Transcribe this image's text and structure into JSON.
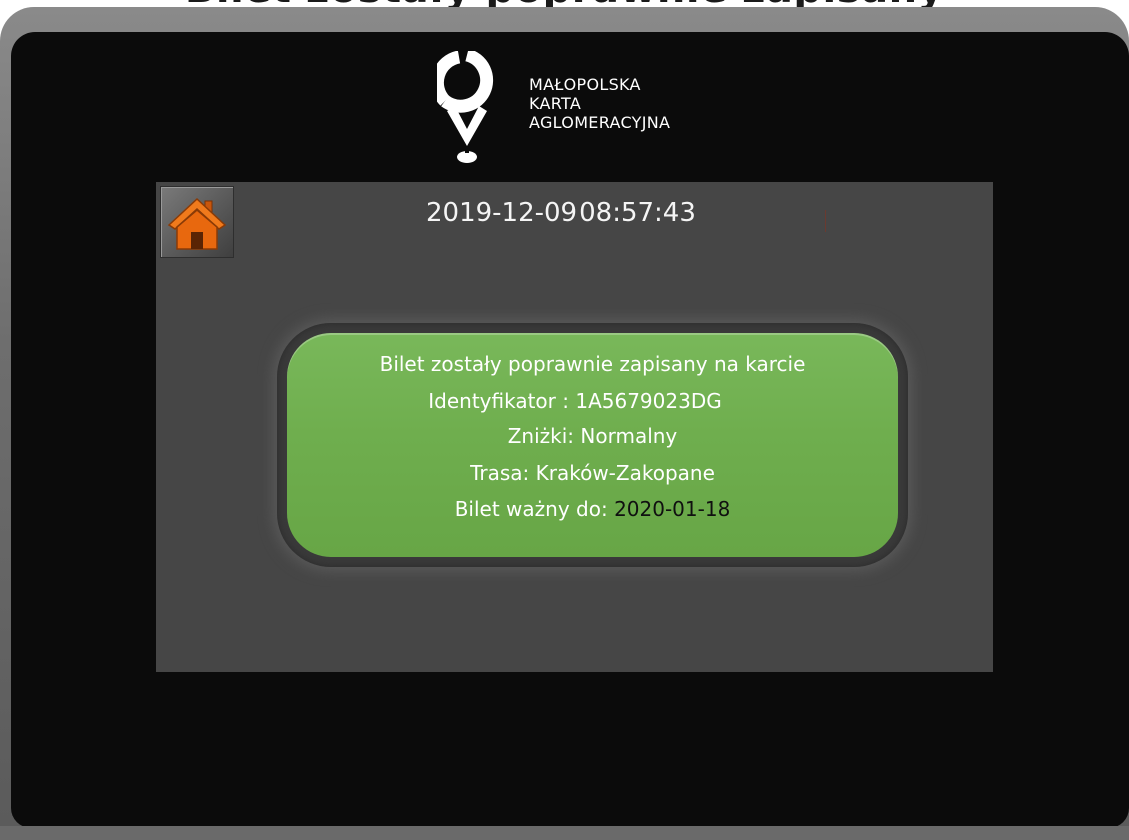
{
  "caption": {
    "text": "Bilet zostały poprawnie zapisany"
  },
  "logo": {
    "icon": "location-pin-logo",
    "lines": [
      "MAŁOPOLSKA",
      "KARTA",
      "AGLOMERACYJNA"
    ]
  },
  "header": {
    "date": "2019-12-09",
    "time": "08:57:43",
    "home_icon": "home-icon"
  },
  "message": {
    "line1": "Bilet zostały poprawnie zapisany na karcie",
    "id_label": "Identyfikator : ",
    "id_value": "1A5679023DG",
    "discount_label": "Zniżki: ",
    "discount_value": "Normalny",
    "route_label": "Trasa: ",
    "route_value": "Kraków-Zakopane",
    "valid_label": "Bilet ważny do: ",
    "valid_value": "2020-01-18"
  },
  "colors": {
    "panel": "#464646",
    "message_green": "#70af4f",
    "home_icon": "#e86a12"
  }
}
